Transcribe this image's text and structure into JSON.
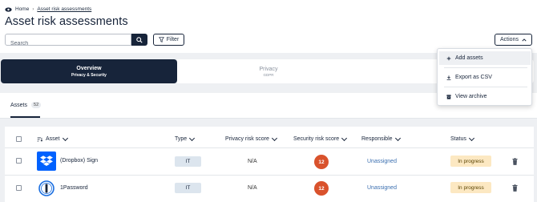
{
  "breadcrumb": {
    "home": "Home",
    "current": "Asset risk assessments"
  },
  "page_title": "Asset risk assessments",
  "search": {
    "placeholder": "Search",
    "value": ""
  },
  "filter_label": "Filter",
  "actions_label": "Actions",
  "tabs": [
    {
      "label": "Overview",
      "sublabel": "Privacy & Security"
    },
    {
      "label": "Privacy",
      "sublabel": "GDPR"
    },
    {
      "label": "",
      "sublabel": ""
    }
  ],
  "subtab": {
    "label": "Assets",
    "count": "52"
  },
  "table": {
    "columns": [
      "Asset",
      "Type",
      "Privacy risk score",
      "Security risk score",
      "Responsible",
      "Status"
    ],
    "rows": [
      {
        "asset": "(Dropbox) Sign",
        "icon": "dropbox-icon",
        "type": "IT",
        "privacy_score": "N/A",
        "security_score": "12",
        "responsible": "Unassigned",
        "status": "In progress"
      },
      {
        "asset": "1Password",
        "icon": "1password-icon",
        "type": "IT",
        "privacy_score": "N/A",
        "security_score": "12",
        "responsible": "Unassigned",
        "status": "In progress"
      }
    ]
  },
  "actions_menu": [
    {
      "label": "Add assets",
      "icon": "plus-icon"
    },
    {
      "label": "Export as CSV",
      "icon": "download-icon"
    },
    {
      "label": "View archive",
      "icon": "archive-icon"
    }
  ],
  "colors": {
    "navy": "#17243a",
    "score_red": "#d9522c",
    "status_bg": "#fce8c2",
    "type_bg": "#dce5ee",
    "link_blue": "#3b6fb0",
    "dropbox_blue": "#0061fe"
  }
}
